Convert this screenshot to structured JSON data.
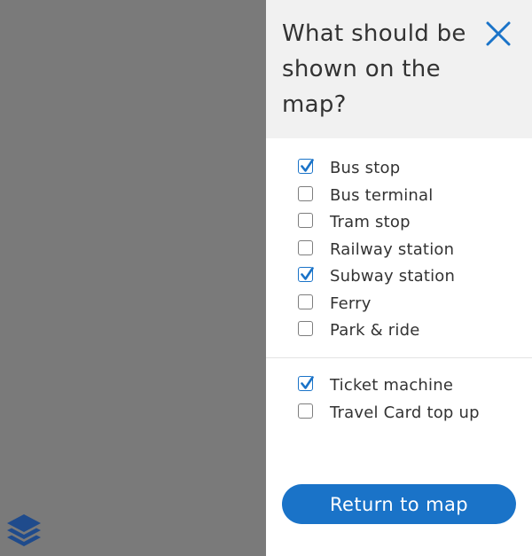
{
  "panel": {
    "title": "What should be shown on the map?",
    "close_icon": "close-icon",
    "accent_color": "#1a73c8"
  },
  "groups": [
    {
      "options": [
        {
          "label": "Bus stop",
          "checked": true
        },
        {
          "label": "Bus terminal",
          "checked": false
        },
        {
          "label": "Tram stop",
          "checked": false
        },
        {
          "label": "Railway station",
          "checked": false
        },
        {
          "label": "Subway station",
          "checked": true
        },
        {
          "label": "Ferry",
          "checked": false
        },
        {
          "label": "Park & ride",
          "checked": false
        }
      ]
    },
    {
      "options": [
        {
          "label": "Ticket machine",
          "checked": true
        },
        {
          "label": "Travel Card top up",
          "checked": false
        }
      ]
    }
  ],
  "actions": {
    "return_label": "Return to map"
  },
  "map": {
    "layers_icon": "layers-icon"
  }
}
